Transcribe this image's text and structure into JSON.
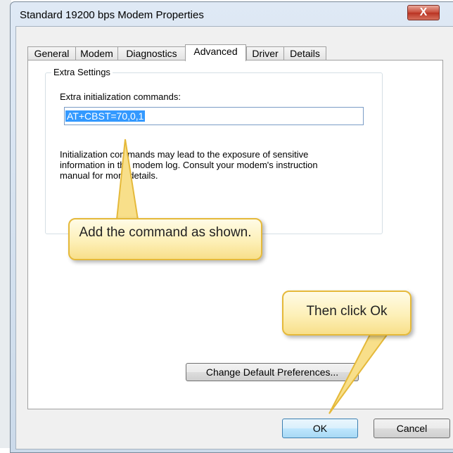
{
  "window": {
    "title": "Standard 19200 bps Modem Properties",
    "close_glyph": "X"
  },
  "tabs": [
    {
      "label": "General"
    },
    {
      "label": "Modem"
    },
    {
      "label": "Diagnostics"
    },
    {
      "label": "Advanced",
      "active": true
    },
    {
      "label": "Driver"
    },
    {
      "label": "Details"
    }
  ],
  "advanced": {
    "group_title": "Extra Settings",
    "field_label": "Extra initialization commands:",
    "command_value": "AT+CBST=70,0,1",
    "info_text": "Initialization commands may lead to the exposure of sensitive information in the modem log. Consult your modem's instruction manual for more details.",
    "change_defaults_label": "Change Default Preferences..."
  },
  "buttons": {
    "ok": "OK",
    "cancel": "Cancel"
  },
  "callouts": {
    "add_command": "Add the command as shown.",
    "click_ok": "Then click Ok"
  },
  "colors": {
    "selection": "#3399ff",
    "callout_fill": "#fdf0b8",
    "callout_border": "#e5b93a",
    "close_button": "#c74a38"
  }
}
